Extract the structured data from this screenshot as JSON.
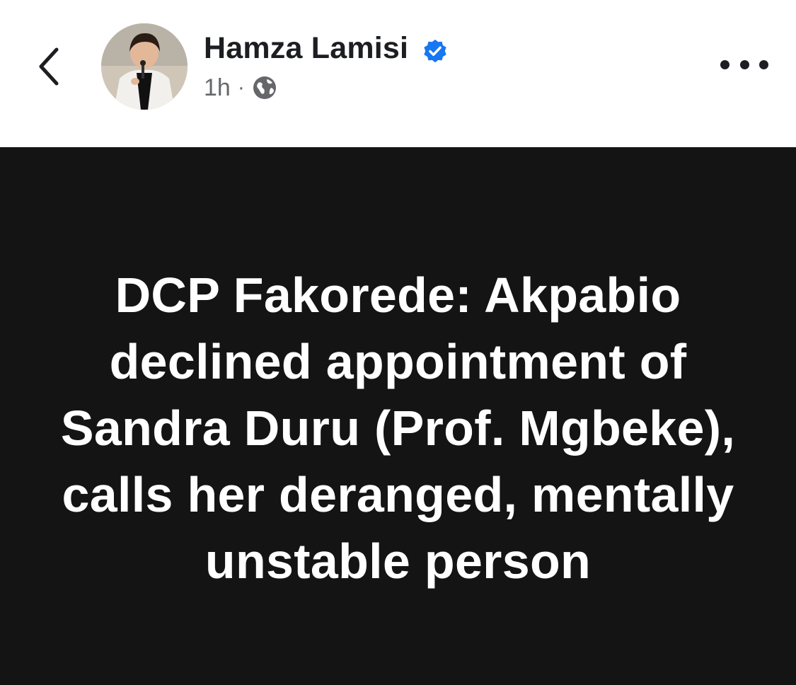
{
  "header": {
    "author_name": "Hamza Lamisi",
    "time_ago": "1h",
    "separator": "·",
    "audience_icon": "globe-icon",
    "verified_icon": "verified-badge-icon",
    "back_icon": "chevron-left-icon",
    "more_icon": "more-horizontal-icon"
  },
  "post": {
    "text": "DCP Fakorede: Akpabio declined appointment of Sandra Duru (Prof. Mgbeke), calls her deranged, mentally unstable person"
  },
  "colors": {
    "verified_blue": "#1877f2",
    "card_background": "#141414",
    "text_primary": "#1c1e21",
    "text_secondary": "#65676b"
  }
}
